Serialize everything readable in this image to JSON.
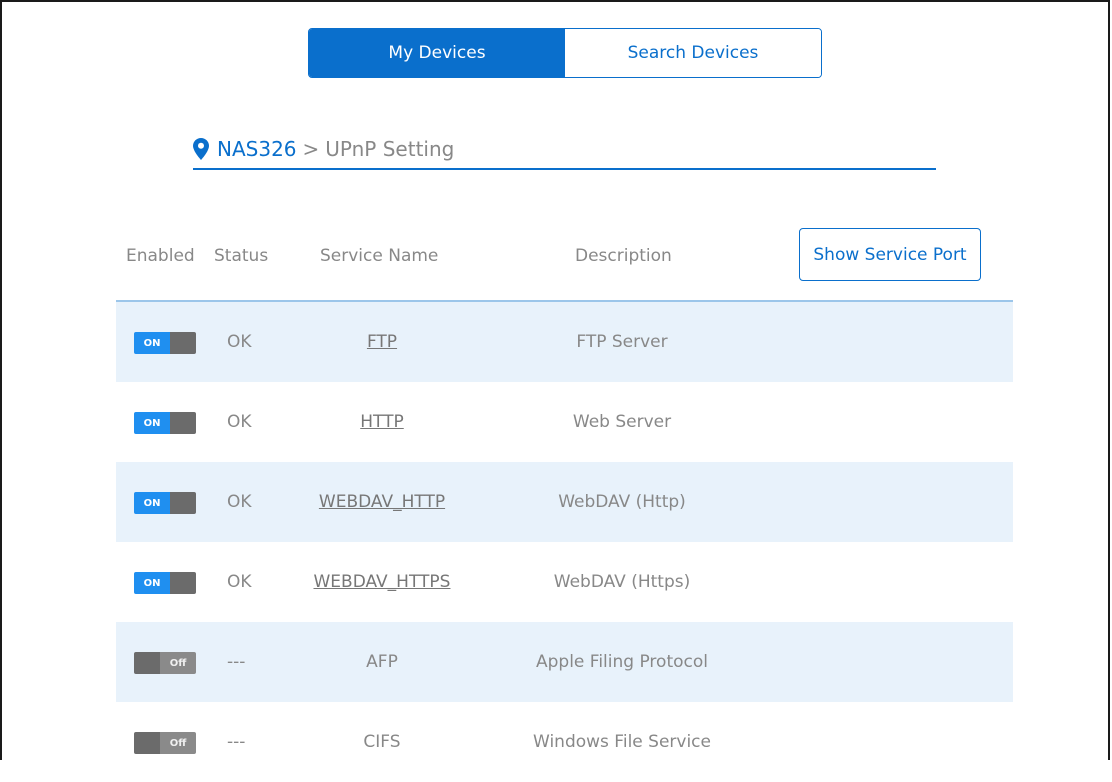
{
  "tabs": {
    "my_devices": "My Devices",
    "search_devices": "Search Devices"
  },
  "breadcrumb": {
    "device": "NAS326",
    "separator": ">",
    "page": "UPnP Setting"
  },
  "table": {
    "headers": {
      "enabled": "Enabled",
      "status": "Status",
      "service_name": "Service Name",
      "description": "Description"
    },
    "show_port_label": "Show Service Port",
    "rows": [
      {
        "toggle": "ON",
        "status": "OK",
        "service": "FTP",
        "description": "FTP Server"
      },
      {
        "toggle": "ON",
        "status": "OK",
        "service": "HTTP",
        "description": "Web Server"
      },
      {
        "toggle": "ON",
        "status": "OK",
        "service": "WEBDAV_HTTP",
        "description": "WebDAV (Http)"
      },
      {
        "toggle": "ON",
        "status": "OK",
        "service": "WEBDAV_HTTPS",
        "description": "WebDAV (Https)"
      },
      {
        "toggle": "Off",
        "status": "---",
        "service": "AFP",
        "description": "Apple Filing Protocol"
      },
      {
        "toggle": "Off",
        "status": "---",
        "service": "CIFS",
        "description": "Windows File Service"
      }
    ]
  },
  "colors": {
    "accent": "#0a6fcc",
    "row_alt": "#e8f2fb",
    "toggle_on": "#1f8ff0",
    "toggle_knob": "#6b6b6b"
  }
}
